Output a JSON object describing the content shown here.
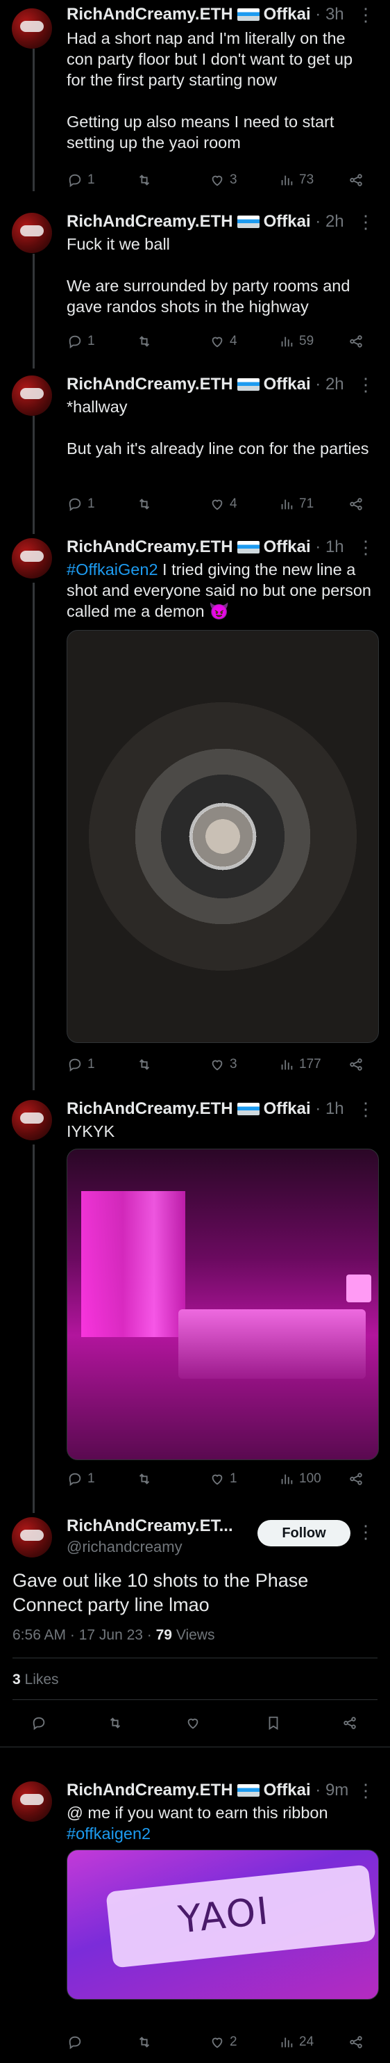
{
  "thread_user": {
    "name": "RichAndCreamy.ETH",
    "affiliation": "Offkai"
  },
  "tweets": [
    {
      "time": "3h",
      "text": "Had a short nap and I'm literally on the con party floor but I don't want to get up for the first party starting now\n\nGetting up also means I need to start setting up the yaoi room",
      "replies": "1",
      "retweets": "",
      "likes": "3",
      "views": "73"
    },
    {
      "time": "2h",
      "text": "Fuck it we ball\n\nWe are surrounded by party rooms and gave randos shots in the highway",
      "replies": "1",
      "retweets": "",
      "likes": "4",
      "views": "59"
    },
    {
      "time": "2h",
      "text": "*hallway\n\nBut yah it's already line con for the parties",
      "replies": "1",
      "retweets": "",
      "likes": "4",
      "views": "71"
    },
    {
      "time": "1h",
      "hashtag": "#OffkaiGen2",
      "text": " I tried giving the new line a shot and everyone said no but one person called me a demon 😈",
      "replies": "1",
      "retweets": "",
      "likes": "3",
      "views": "177"
    },
    {
      "time": "1h",
      "text": "IYKYK",
      "replies": "1",
      "retweets": "",
      "likes": "1",
      "views": "100"
    }
  ],
  "main_tweet": {
    "name": "RichAndCreamy.ET...",
    "handle": "@richandcreamy",
    "follow_label": "Follow",
    "text": "Gave out like 10 shots to the Phase Connect party line lmao",
    "timestamp": "6:56 AM · 17 Jun 23 · ",
    "views_count": "79",
    "views_label": " Views",
    "likes_count": "3",
    "likes_label": " Likes"
  },
  "reply_tweet": {
    "time": "9m",
    "text": "@ me if you want to earn this ribbon",
    "hashtag": "#offkaigen2",
    "ribbon_text": "YAOI",
    "replies": "",
    "retweets": "",
    "likes": "2",
    "views": "24"
  },
  "icons": [
    "reply-icon",
    "retweet-icon",
    "like-icon",
    "views-icon",
    "share-icon",
    "bookmark-icon",
    "more-icon"
  ]
}
